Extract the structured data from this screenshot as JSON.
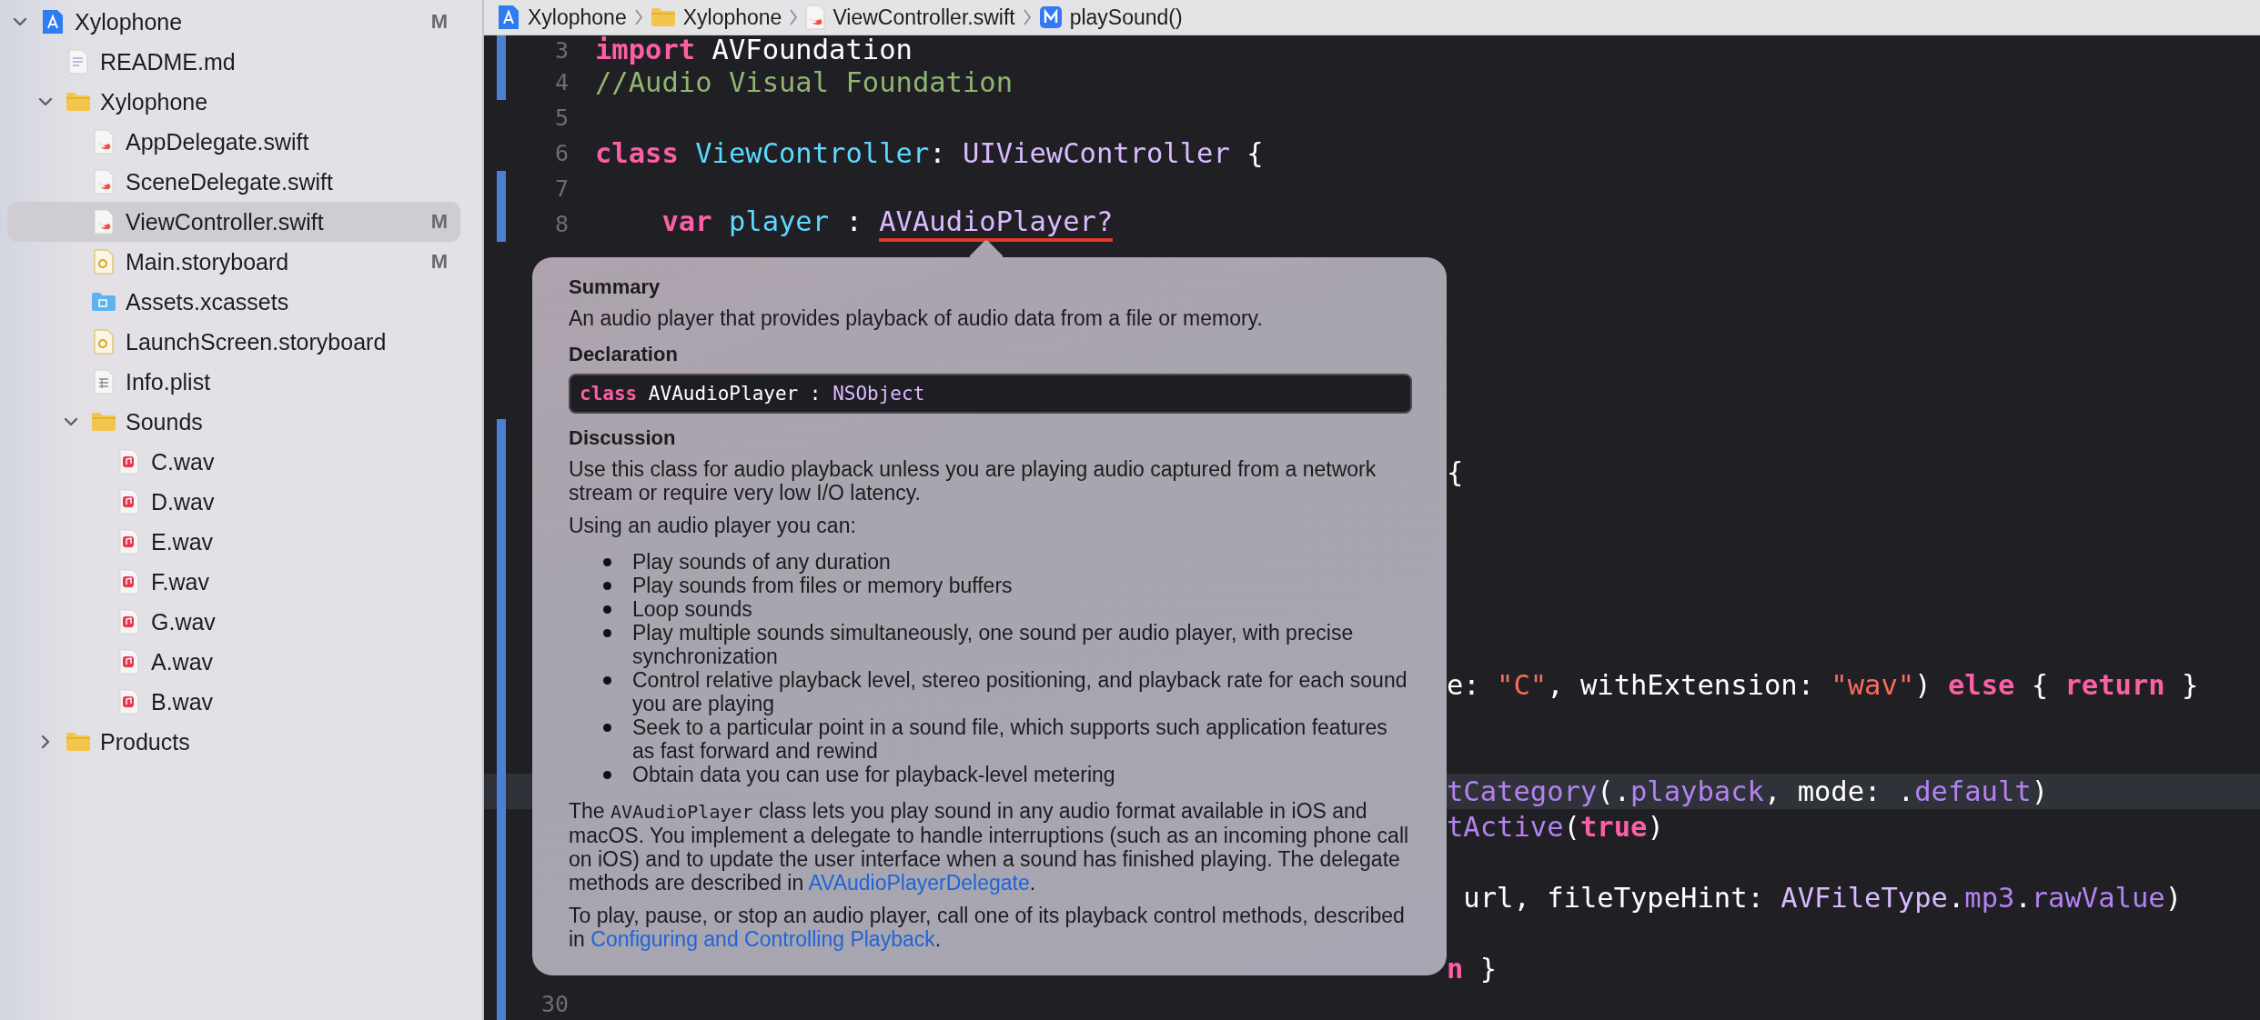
{
  "navigator": {
    "items": [
      {
        "label": "Xylophone",
        "kind": "project",
        "status": "M",
        "selected": false,
        "expanded": true,
        "children": [
          {
            "label": "README.md",
            "kind": "markdown",
            "selected": false
          },
          {
            "label": "Xylophone",
            "kind": "folder",
            "selected": false,
            "expanded": true,
            "children": [
              {
                "label": "AppDelegate.swift",
                "kind": "swift",
                "selected": false
              },
              {
                "label": "SceneDelegate.swift",
                "kind": "swift",
                "selected": false
              },
              {
                "label": "ViewController.swift",
                "kind": "swift",
                "status": "M",
                "selected": true
              },
              {
                "label": "Main.storyboard",
                "kind": "storyboard",
                "status": "M",
                "selected": false
              },
              {
                "label": "Assets.xcassets",
                "kind": "assets",
                "selected": false
              },
              {
                "label": "LaunchScreen.storyboard",
                "kind": "storyboard",
                "selected": false
              },
              {
                "label": "Info.plist",
                "kind": "plist",
                "selected": false
              },
              {
                "label": "Sounds",
                "kind": "folder",
                "selected": false,
                "expanded": true,
                "children": [
                  {
                    "label": "C.wav",
                    "kind": "audio",
                    "selected": false
                  },
                  {
                    "label": "D.wav",
                    "kind": "audio",
                    "selected": false
                  },
                  {
                    "label": "E.wav",
                    "kind": "audio",
                    "selected": false
                  },
                  {
                    "label": "F.wav",
                    "kind": "audio",
                    "selected": false
                  },
                  {
                    "label": "G.wav",
                    "kind": "audio",
                    "selected": false
                  },
                  {
                    "label": "A.wav",
                    "kind": "audio",
                    "selected": false
                  },
                  {
                    "label": "B.wav",
                    "kind": "audio",
                    "selected": false
                  }
                ]
              }
            ]
          },
          {
            "label": "Products",
            "kind": "folder",
            "selected": false,
            "expanded": false
          }
        ]
      }
    ]
  },
  "breadcrumb": [
    {
      "label": "Xylophone",
      "kind": "project"
    },
    {
      "label": "Xylophone",
      "kind": "folder"
    },
    {
      "label": "ViewController.swift",
      "kind": "swift"
    },
    {
      "label": "playSound()",
      "kind": "method"
    }
  ],
  "editor": {
    "lines": [
      {
        "number": "3",
        "changed": true,
        "current": false,
        "tokens": [
          {
            "text": "import",
            "kind": "keyword"
          },
          {
            "text": " AVFoundation",
            "kind": "plain"
          }
        ]
      },
      {
        "number": "4",
        "changed": true,
        "current": false,
        "tokens": [
          {
            "text": "//Audio Visual Foundation",
            "kind": "comment"
          }
        ]
      },
      {
        "number": "5",
        "changed": false,
        "current": false
      },
      {
        "number": "6",
        "changed": false,
        "current": false,
        "tokens": [
          {
            "text": "class",
            "kind": "keyword"
          },
          {
            "text": " ViewController",
            "kind": "declaration"
          },
          {
            "text": ": ",
            "kind": "plain"
          },
          {
            "text": "UIViewController",
            "kind": "type"
          },
          {
            "text": " {",
            "kind": "plain"
          }
        ]
      },
      {
        "number": "7",
        "changed": true,
        "current": false
      },
      {
        "number": "8",
        "changed": true,
        "current": false,
        "tokens": [
          {
            "text": "    var",
            "kind": "keyword"
          },
          {
            "text": " player",
            "kind": "declaration"
          },
          {
            "text": " : ",
            "kind": "plain"
          },
          {
            "text": "AVAudioPlayer?",
            "kind": "type",
            "flagged": true
          }
        ]
      },
      {
        "changed": false,
        "current": false
      },
      {
        "changed": false,
        "current": false
      },
      {
        "changed": false,
        "current": false
      },
      {
        "changed": false,
        "current": false
      },
      {
        "changed": false,
        "current": false
      },
      {
        "changed": true,
        "current": false
      },
      {
        "changed": true,
        "current": false,
        "right_tokens": [
          {
            "text": "{",
            "kind": "plain"
          }
        ]
      },
      {
        "changed": true,
        "current": false
      },
      {
        "changed": true,
        "current": false
      },
      {
        "changed": true,
        "current": false
      },
      {
        "changed": true,
        "current": false
      },
      {
        "changed": true,
        "current": false
      },
      {
        "changed": true,
        "current": false,
        "right_tokens": [
          {
            "text": "e: ",
            "kind": "plain"
          },
          {
            "text": "\"C\"",
            "kind": "string"
          },
          {
            "text": ", withExtension: ",
            "kind": "plain"
          },
          {
            "text": "\"wav\"",
            "kind": "string"
          },
          {
            "text": ") ",
            "kind": "plain"
          },
          {
            "text": "else",
            "kind": "keyword"
          },
          {
            "text": " { ",
            "kind": "plain"
          },
          {
            "text": "return",
            "kind": "keyword"
          },
          {
            "text": " }",
            "kind": "plain"
          }
        ]
      },
      {
        "changed": true,
        "current": false
      },
      {
        "changed": true,
        "current": false
      },
      {
        "changed": true,
        "current": true,
        "right_tokens": [
          {
            "text": "tCategory",
            "kind": "member"
          },
          {
            "text": "(.",
            "kind": "plain"
          },
          {
            "text": "playback",
            "kind": "member"
          },
          {
            "text": ", mode: .",
            "kind": "plain"
          },
          {
            "text": "default",
            "kind": "member"
          },
          {
            "text": ")",
            "kind": "plain"
          }
        ]
      },
      {
        "changed": true,
        "current": false,
        "right_tokens": [
          {
            "text": "tActive",
            "kind": "member"
          },
          {
            "text": "(",
            "kind": "plain"
          },
          {
            "text": "true",
            "kind": "keyword"
          },
          {
            "text": ")",
            "kind": "plain"
          }
        ]
      },
      {
        "changed": true,
        "current": false
      },
      {
        "changed": true,
        "current": false,
        "right_tokens": [
          {
            "text": " url, fileTypeHint: ",
            "kind": "plain"
          },
          {
            "text": "AVFileType",
            "kind": "type"
          },
          {
            "text": ".",
            "kind": "plain"
          },
          {
            "text": "mp3",
            "kind": "member"
          },
          {
            "text": ".",
            "kind": "plain"
          },
          {
            "text": "rawValue",
            "kind": "member"
          },
          {
            "text": ")",
            "kind": "plain"
          }
        ]
      },
      {
        "changed": true,
        "current": false
      },
      {
        "changed": true,
        "current": false,
        "right_tokens": [
          {
            "text": "n",
            "kind": "keyword"
          },
          {
            "text": " }",
            "kind": "plain"
          }
        ]
      },
      {
        "number": "30",
        "changed": true,
        "current": false
      }
    ]
  },
  "quick_help": {
    "sections": [
      {
        "heading": "Summary",
        "blocks": [
          {
            "kind": "paragraph",
            "parts": [
              {
                "text": "An audio player that provides playback of audio data from a file or memory.",
                "kind": "text"
              }
            ]
          }
        ]
      },
      {
        "heading": "Declaration",
        "blocks": [
          {
            "kind": "code",
            "tokens": [
              {
                "text": "class",
                "kind": "keyword"
              },
              {
                "text": " AVAudioPlayer : ",
                "kind": "plain"
              },
              {
                "text": "NSObject",
                "kind": "type"
              }
            ]
          }
        ]
      },
      {
        "heading": "Discussion",
        "blocks": [
          {
            "kind": "paragraph",
            "parts": [
              {
                "text": "Use this class for audio playback unless you are playing audio captured from a network stream or require very low I/O latency.",
                "kind": "text"
              }
            ]
          },
          {
            "kind": "paragraph",
            "parts": [
              {
                "text": "Using an audio player you can:",
                "kind": "text"
              }
            ]
          },
          {
            "kind": "list",
            "items": [
              "Play sounds of any duration",
              "Play sounds from files or memory buffers",
              "Loop sounds",
              "Play multiple sounds simultaneously, one sound per audio player, with precise synchronization",
              "Control relative playback level, stereo positioning, and playback rate for each sound you are playing",
              "Seek to a particular point in a sound file, which supports such application features as fast forward and rewind",
              "Obtain data you can use for playback-level metering"
            ]
          },
          {
            "kind": "paragraph",
            "parts": [
              {
                "text": "The ",
                "kind": "text"
              },
              {
                "text": "AVAudioPlayer",
                "kind": "code"
              },
              {
                "text": " class lets you play sound in any audio format available in iOS and macOS. You implement a delegate to handle interruptions (such as an incoming phone call on iOS) and to update the user interface when a sound has finished playing. The delegate methods are described in ",
                "kind": "text"
              },
              {
                "text": "AVAudioPlayerDelegate",
                "kind": "link"
              },
              {
                "text": ".",
                "kind": "text"
              }
            ]
          },
          {
            "kind": "paragraph",
            "parts": [
              {
                "text": "To play, pause, or stop an audio player, call one of its playback control methods, described in ",
                "kind": "text"
              },
              {
                "text": "Configuring and Controlling Playback",
                "kind": "link"
              },
              {
                "text": ".",
                "kind": "text"
              }
            ]
          }
        ]
      }
    ]
  }
}
